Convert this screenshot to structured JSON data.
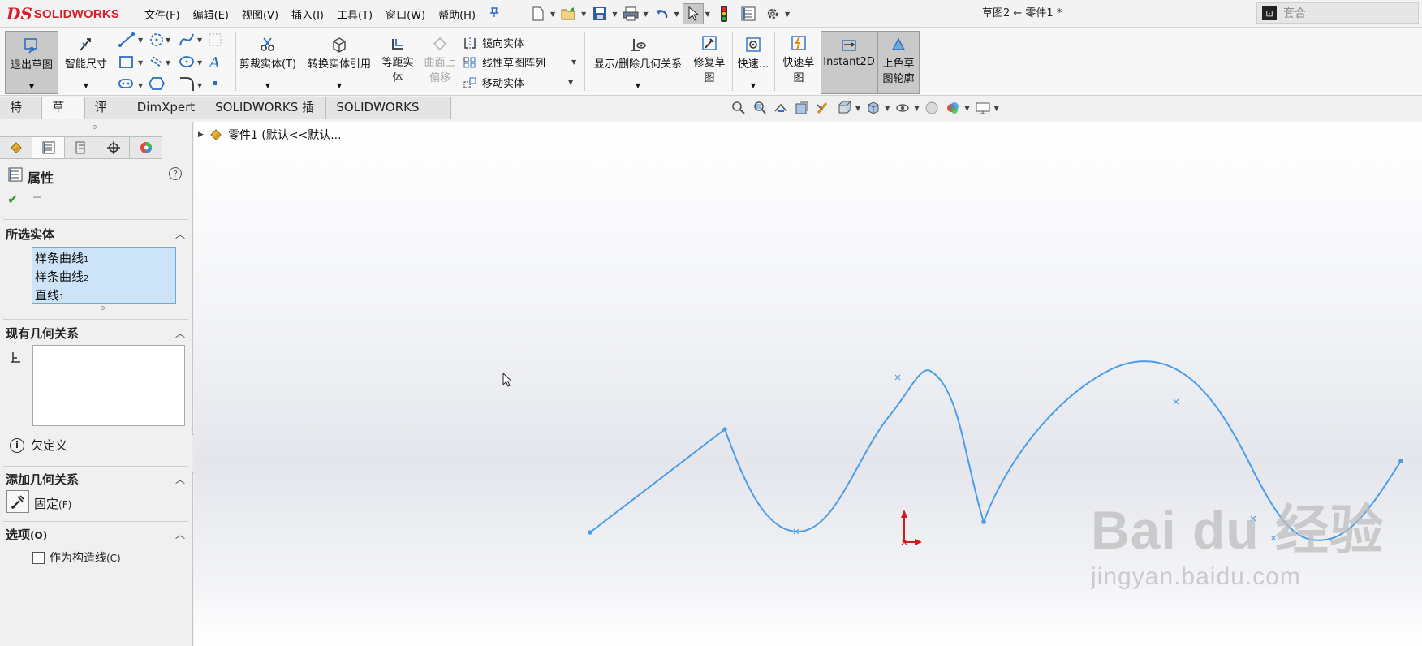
{
  "app": {
    "logo_mark": "DS",
    "logo_text": "SOLIDWORKS",
    "title": "草图2 ← 零件1 *"
  },
  "menu": [
    "文件(F)",
    "编辑(E)",
    "视图(V)",
    "插入(I)",
    "工具(T)",
    "窗口(W)",
    "帮助(H)"
  ],
  "search": {
    "placeholder": "套合"
  },
  "ribbon": {
    "exit_sketch": "退出草图",
    "smart_dim": "智能尺寸",
    "trim": "剪裁实体(T)",
    "convert": "转换实体引用",
    "offset": [
      "等距实",
      "体"
    ],
    "surface_offset": [
      "曲面上",
      "偏移"
    ],
    "mirror": "镜向实体",
    "linear_pattern": "线性草图阵列",
    "move": "移动实体",
    "show_relations": "显示/删除几何关系",
    "repair": [
      "修复草",
      "图"
    ],
    "quick_snap": "快速...",
    "rapid_sketch": [
      "快速草",
      "图"
    ],
    "instant2d": "Instant2D",
    "shaded_contours": [
      "上色草",
      "图轮廓"
    ]
  },
  "tabs": [
    "特征",
    "草图",
    "评估",
    "DimXpert",
    "SOLIDWORKS 插件",
    "SOLIDWORKS MBD"
  ],
  "panel": {
    "title": "属性",
    "selected_section": "所选实体",
    "selected_items": [
      {
        "name": "样条曲线",
        "sub": "1"
      },
      {
        "name": "样条曲线",
        "sub": "2"
      },
      {
        "name": "直线",
        "sub": "1"
      }
    ],
    "existing_section": "现有几何关系",
    "status": "欠定义",
    "add_section": "添加几何关系",
    "fix_label": "固定",
    "fix_key": "(F)",
    "options_section": "选项",
    "options_key": "(O)",
    "construction_label": "作为构造线",
    "construction_key": "(C)",
    "construction_checked": false
  },
  "tree": {
    "label": "零件1 (默认<<默认..."
  },
  "watermark": {
    "main": "Bai du 经验",
    "sub": "jingyan.baidu.com"
  },
  "colors": {
    "sketch_line": "#4a9de8",
    "origin": "#d11a1a",
    "selection_fill": "#cde3f7",
    "brand": "#d81e2c"
  },
  "icons": {
    "exit_sketch": "exit-sketch-icon",
    "smart_dimension": "smart-dimension-icon",
    "mirror": "mirror-icon",
    "fix": "fix-icon",
    "origin": "origin-icon"
  }
}
